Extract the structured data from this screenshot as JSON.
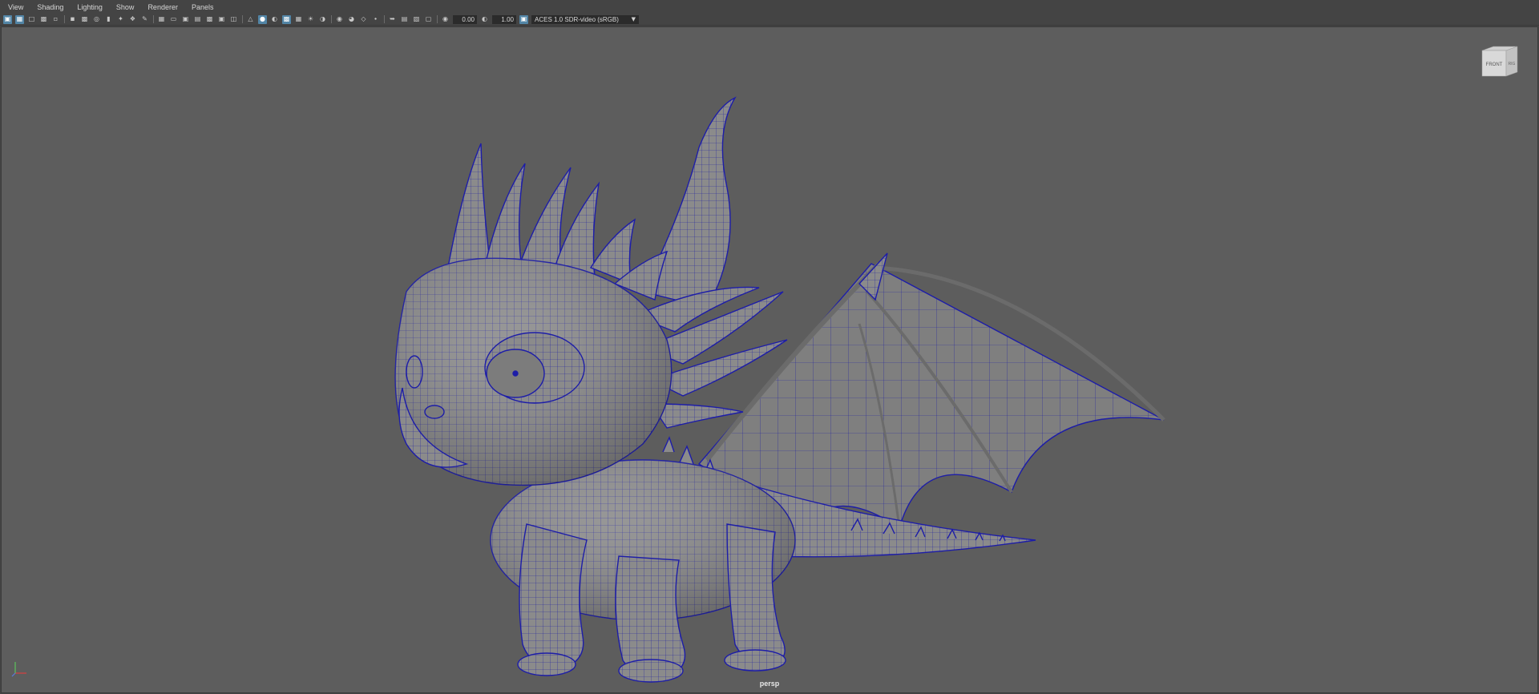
{
  "menubar": {
    "items": [
      "View",
      "Shading",
      "Lighting",
      "Show",
      "Renderer",
      "Panels"
    ]
  },
  "toolbar": {
    "exposure_value": "0.00",
    "gamma_value": "1.00",
    "color_space": "ACES 1.0 SDR-video (sRGB)"
  },
  "viewport": {
    "camera_name": "persp",
    "viewcube_face": "FRONT",
    "viewcube_side": "RIG",
    "background_color": "#5d5d5d",
    "wireframe_color": "#1d1da8",
    "model_color": "#8a8a8a"
  },
  "icons": [
    "select-camera-icon",
    "camera-attributes-icon",
    "bookmark-icon",
    "grid-icon",
    "resolution-gate-icon",
    "wireframe-icon",
    "smooth-shade-icon",
    "textured-icon",
    "lights-icon",
    "shadows-icon",
    "isolate-icon",
    "xray-icon",
    "exposure-icon",
    "gamma-icon",
    "color-management-icon"
  ],
  "accent_color": "#5285a6"
}
